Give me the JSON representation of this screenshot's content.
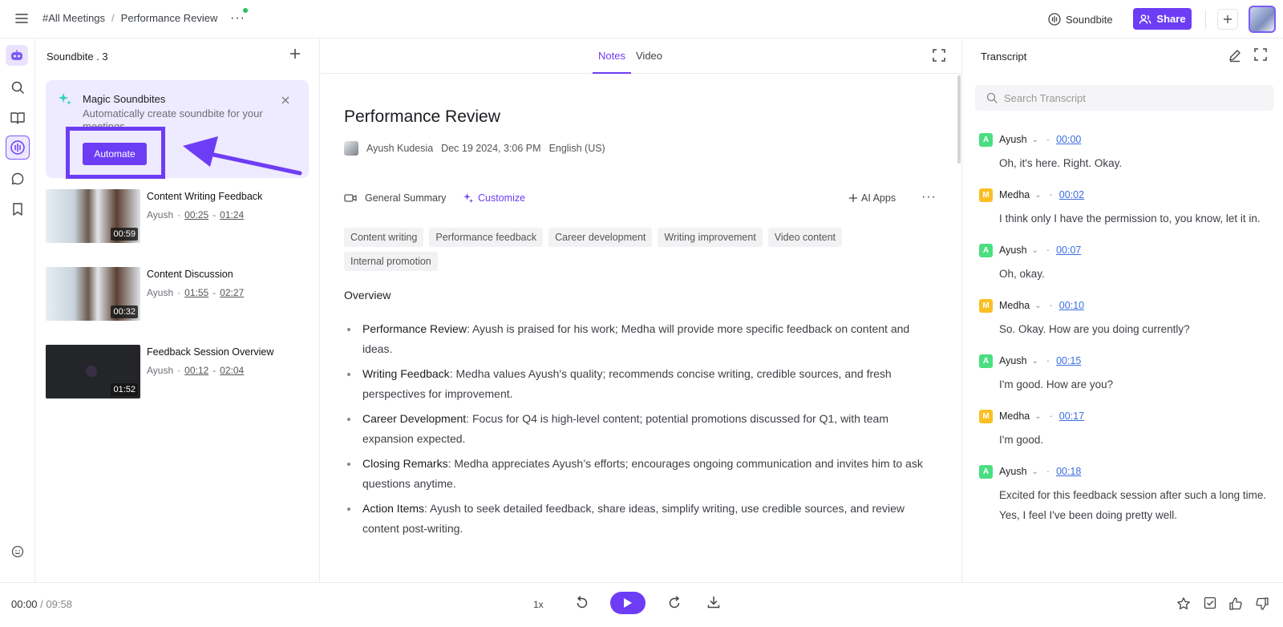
{
  "topbar": {
    "breadcrumb": [
      "#All Meetings",
      "Performance Review"
    ],
    "breadcrumb_sep": "/",
    "soundbite_label": "Soundbite",
    "share_label": "Share"
  },
  "soundbites": {
    "title": "Soundbite . 3",
    "magic": {
      "title": "Magic Soundbites",
      "subtitle": "Automatically create soundbite for your meetings",
      "button": "Automate"
    },
    "clips": [
      {
        "title": "Content Writing Feedback",
        "speaker": "Ayush",
        "start": "00:25",
        "end": "01:24",
        "duration": "00:59"
      },
      {
        "title": "Content Discussion",
        "speaker": "Ayush",
        "start": "01:55",
        "end": "02:27",
        "duration": "00:32"
      },
      {
        "title": "Feedback Session Overview",
        "speaker": "Ayush",
        "start": "00:12",
        "end": "02:04",
        "duration": "01:52"
      }
    ]
  },
  "notes": {
    "tabs": [
      "Notes",
      "Video"
    ],
    "active_tab": "Notes",
    "title": "Performance Review",
    "author": "Ayush Kudesia",
    "date": "Dec 19 2024, 3:06 PM",
    "language": "English (US)",
    "summary_label": "General Summary",
    "customize_label": "Customize",
    "ai_apps_label": "AI Apps",
    "tags": [
      "Content writing",
      "Performance feedback",
      "Career development",
      "Writing improvement",
      "Video content",
      "Internal promotion"
    ],
    "overview_heading": "Overview",
    "bullets": [
      {
        "head": "Performance Review",
        "text": ": Ayush is praised for his work; Medha will provide more specific feedback on content and ideas."
      },
      {
        "head": "Writing Feedback",
        "text": ": Medha values Ayush's quality; recommends concise writing, credible sources, and fresh perspectives for improvement."
      },
      {
        "head": "Career Development",
        "text": ": Focus for Q4 is high-level content; potential promotions discussed for Q1, with team expansion expected."
      },
      {
        "head": "Closing Remarks",
        "text": ": Medha appreciates Ayush’s efforts; encourages ongoing communication and invites him to ask questions anytime."
      },
      {
        "head": "Action Items",
        "text": ": Ayush to seek detailed feedback, share ideas, simplify writing, use credible sources, and review content post-writing."
      }
    ]
  },
  "transcript": {
    "title": "Transcript",
    "search_placeholder": "Search Transcript",
    "entries": [
      {
        "initial": "A",
        "speaker": "Ayush",
        "time": "00:00",
        "text": "Oh, it's here. Right. Okay."
      },
      {
        "initial": "M",
        "speaker": "Medha",
        "time": "00:02",
        "text": "I think only I have the permission to, you know, let it in."
      },
      {
        "initial": "A",
        "speaker": "Ayush",
        "time": "00:07",
        "text": "Oh, okay."
      },
      {
        "initial": "M",
        "speaker": "Medha",
        "time": "00:10",
        "text": "So. Okay. How are you doing currently?"
      },
      {
        "initial": "A",
        "speaker": "Ayush",
        "time": "00:15",
        "text": "I'm good. How are you?"
      },
      {
        "initial": "M",
        "speaker": "Medha",
        "time": "00:17",
        "text": "I'm good."
      },
      {
        "initial": "A",
        "speaker": "Ayush",
        "time": "00:18",
        "text": "Excited for this feedback session after such a long time. Yes, I feel I've been doing pretty well."
      }
    ]
  },
  "player": {
    "current": "00:00",
    "separator": "/",
    "duration": "09:58",
    "speed": "1x"
  },
  "colors": {
    "accent": "#6d3df5",
    "link": "#3b6ee0",
    "badge_a": "#4ade80",
    "badge_m": "#fbbf24"
  }
}
